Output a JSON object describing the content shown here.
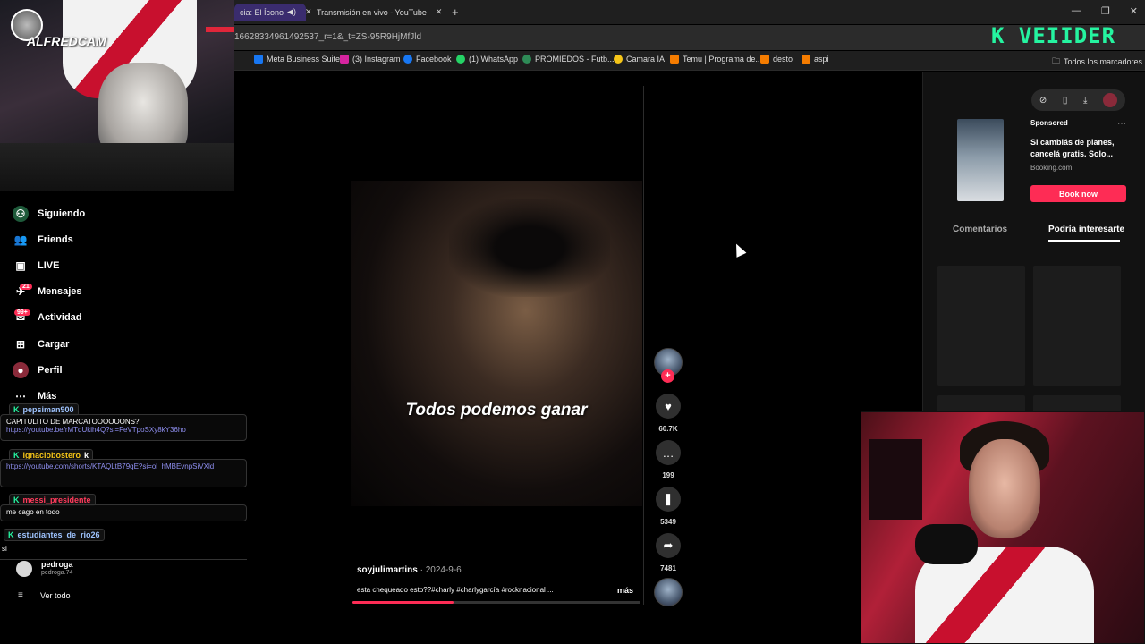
{
  "browser": {
    "tabs": [
      {
        "label": "cia: El Ícono",
        "active": true
      },
      {
        "label": "Transmisión en vivo - YouTube",
        "active": false
      }
    ],
    "url": "16628334961492537_r=1&_t=ZS-95R9HjMfJld",
    "bookmarks": [
      "Meta Business Suite",
      "(3) Instagram",
      "Facebook",
      "(1) WhatsApp",
      "PROMIEDOS - Futb...",
      "Camara IA",
      "Temu | Programa de...",
      "desto",
      "aspi"
    ],
    "all_bookmarks": "Todos los marcadores"
  },
  "overlay": {
    "logo": "K VEIIDER",
    "cam_label": "ALFREDCAM"
  },
  "nav": {
    "items": [
      {
        "label": "Siguiendo",
        "icon": "following-icon"
      },
      {
        "label": "Friends",
        "icon": "friends-icon"
      },
      {
        "label": "LIVE",
        "icon": "live-icon"
      },
      {
        "label": "Mensajes",
        "icon": "messages-icon",
        "badge": "21"
      },
      {
        "label": "Actividad",
        "icon": "activity-icon",
        "badge": "99+"
      },
      {
        "label": "Cargar",
        "icon": "upload-icon"
      },
      {
        "label": "Perfil",
        "icon": "profile-icon"
      },
      {
        "label": "Más",
        "icon": "more-icon"
      }
    ],
    "following_user": {
      "name": "pedroga",
      "handle": "pedroga.74"
    },
    "see_all": "Ver todo"
  },
  "chat": {
    "messages": [
      {
        "user": "pepsiman900",
        "text": "CAPITULITO DE MARCATOOOOOONS?"
      },
      {
        "user": "",
        "text": "https://youtube.be/rMTqUkih4Q?si=FeVTpoSXy8kY36ho"
      },
      {
        "user": "ignaciobostero",
        "text": "https://youtube.com/shorts/KTAQLtB79qE?si=ol_hMBEvnpSiVXld",
        "suffix": "k"
      },
      {
        "user": "messi_presidente",
        "text": "me cago en todo"
      },
      {
        "user": "estudiantes_de_rio26",
        "text": "si"
      }
    ]
  },
  "video": {
    "caption": "Todos podemos ganar",
    "author": "soyjulimartins",
    "date": "2024-9-6",
    "description": "esta chequeado esto??#charly #charlygarcía #rocknacional ...",
    "more": "más",
    "progress": 0.35
  },
  "actions": {
    "likes": "60.7K",
    "comments": "199",
    "saves": "5349",
    "shares": "7481"
  },
  "ad": {
    "sponsored": "Sponsored",
    "title": "Si cambiás de planes, cancelá gratis. Solo...",
    "site": "Booking.com",
    "button": "Book now"
  },
  "right_tabs": [
    "Comentarios",
    "Podría interesarte"
  ],
  "colors": {
    "accent": "#fe2c55",
    "logo": "#25f4a0",
    "link": "#8f8ff0"
  }
}
